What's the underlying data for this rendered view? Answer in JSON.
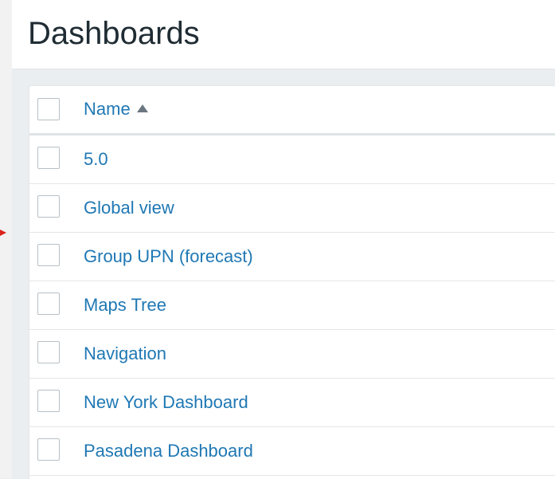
{
  "page": {
    "title": "Dashboards"
  },
  "table": {
    "header": {
      "name_label": "Name",
      "sort_direction": "ascending"
    },
    "rows": [
      {
        "name": "5.0"
      },
      {
        "name": "Global view"
      },
      {
        "name": "Group UPN (forecast)"
      },
      {
        "name": "Maps Tree"
      },
      {
        "name": "Navigation"
      },
      {
        "name": "New York Dashboard"
      },
      {
        "name": "Pasadena Dashboard"
      }
    ]
  },
  "colors": {
    "link": "#1f78b4",
    "title": "#1f2c33",
    "background": "#ebeef0",
    "pointer": "#d9251c"
  },
  "icons": {
    "sort": "sort-ascending-icon",
    "pointer": "red-pointer-icon"
  }
}
